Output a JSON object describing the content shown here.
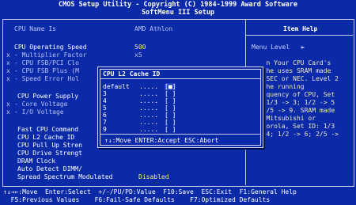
{
  "header": {
    "line1": "CMOS Setup Utility - Copyright (C) 1984-1999 Award Software",
    "line2": "SoftMenu III Setup"
  },
  "left_items": [
    {
      "prefix": "",
      "label": "CPU Name Is",
      "value": "AMD Athlon"
    },
    {
      "prefix": "",
      "label": "CPU Operating Speed",
      "value": "500"
    },
    {
      "prefix": "x",
      "label": "- Multiplier Factor",
      "value": "x5"
    },
    {
      "prefix": "x",
      "label": "- CPU FSB/PCI Clo",
      "value": ""
    },
    {
      "prefix": "x",
      "label": "- CPU FSB Plus (M",
      "value": ""
    },
    {
      "prefix": "x",
      "label": "- Speed Error Hol",
      "value": ""
    },
    {
      "prefix": "",
      "label": "CPU Power Supply",
      "value": ""
    },
    {
      "prefix": "x",
      "label": "- Core Voltage",
      "value": ""
    },
    {
      "prefix": "x",
      "label": "- I/O Voltage",
      "value": ""
    },
    {
      "prefix": "",
      "label": "Fast CPU Command",
      "value": ""
    },
    {
      "prefix": "",
      "label": "CPU L2 Cache ID",
      "value": ""
    },
    {
      "prefix": "",
      "label": "CPU Pull Up Stren",
      "value": ""
    },
    {
      "prefix": "",
      "label": "CPU Drive Strengt",
      "value": ""
    },
    {
      "prefix": "",
      "label": "DRAM Clock",
      "value": ""
    },
    {
      "prefix": "",
      "label": "Auto Detect DIMM/",
      "value": ""
    },
    {
      "prefix": "",
      "label": "Spread Spectrum Modulated",
      "value": "Disabled"
    }
  ],
  "help": {
    "title": "Item Help",
    "menu_level": "Menu Level   ►",
    "lines": [
      "   n Your CPU Card's",
      "   he uses SRAM made",
      "   SEC or NEC. Level 2",
      "   he running",
      "   quency of CPU, Set",
      "   1/3 -> 3; 1/2 -> 5",
      "   /5 -> 9. SRAM made",
      "   Mitsubishi or",
      "   orola, Set ID: 1/3",
      "   4; 1/2 -> 6; 2/5 ->"
    ]
  },
  "popup": {
    "title": "CPU L2 Cache ID",
    "options": [
      {
        "label": "default",
        "dots": ".....",
        "mark": "[■]"
      },
      {
        "label": "3",
        "dots": ".....",
        "mark": "[ ]"
      },
      {
        "label": "4",
        "dots": ".....",
        "mark": "[ ]"
      },
      {
        "label": "5",
        "dots": ".....",
        "mark": "[ ]"
      },
      {
        "label": "6",
        "dots": ".....",
        "mark": "[ ]"
      },
      {
        "label": "7",
        "dots": ".....",
        "mark": "[ ]"
      },
      {
        "label": "9",
        "dots": ".....",
        "mark": "[ ]"
      }
    ],
    "hint": "↑↓:Move ENTER:Accept ESC:Abort"
  },
  "footer": {
    "row1": "↑↓→←:Move  Enter:Select  +/-/PU/PD:Value  F10:Save  ESC:Exit  F1:General Help",
    "row2": "  F5:Previous Values    F6:Fail-Safe Defaults    F7:Optimized Defaults"
  }
}
